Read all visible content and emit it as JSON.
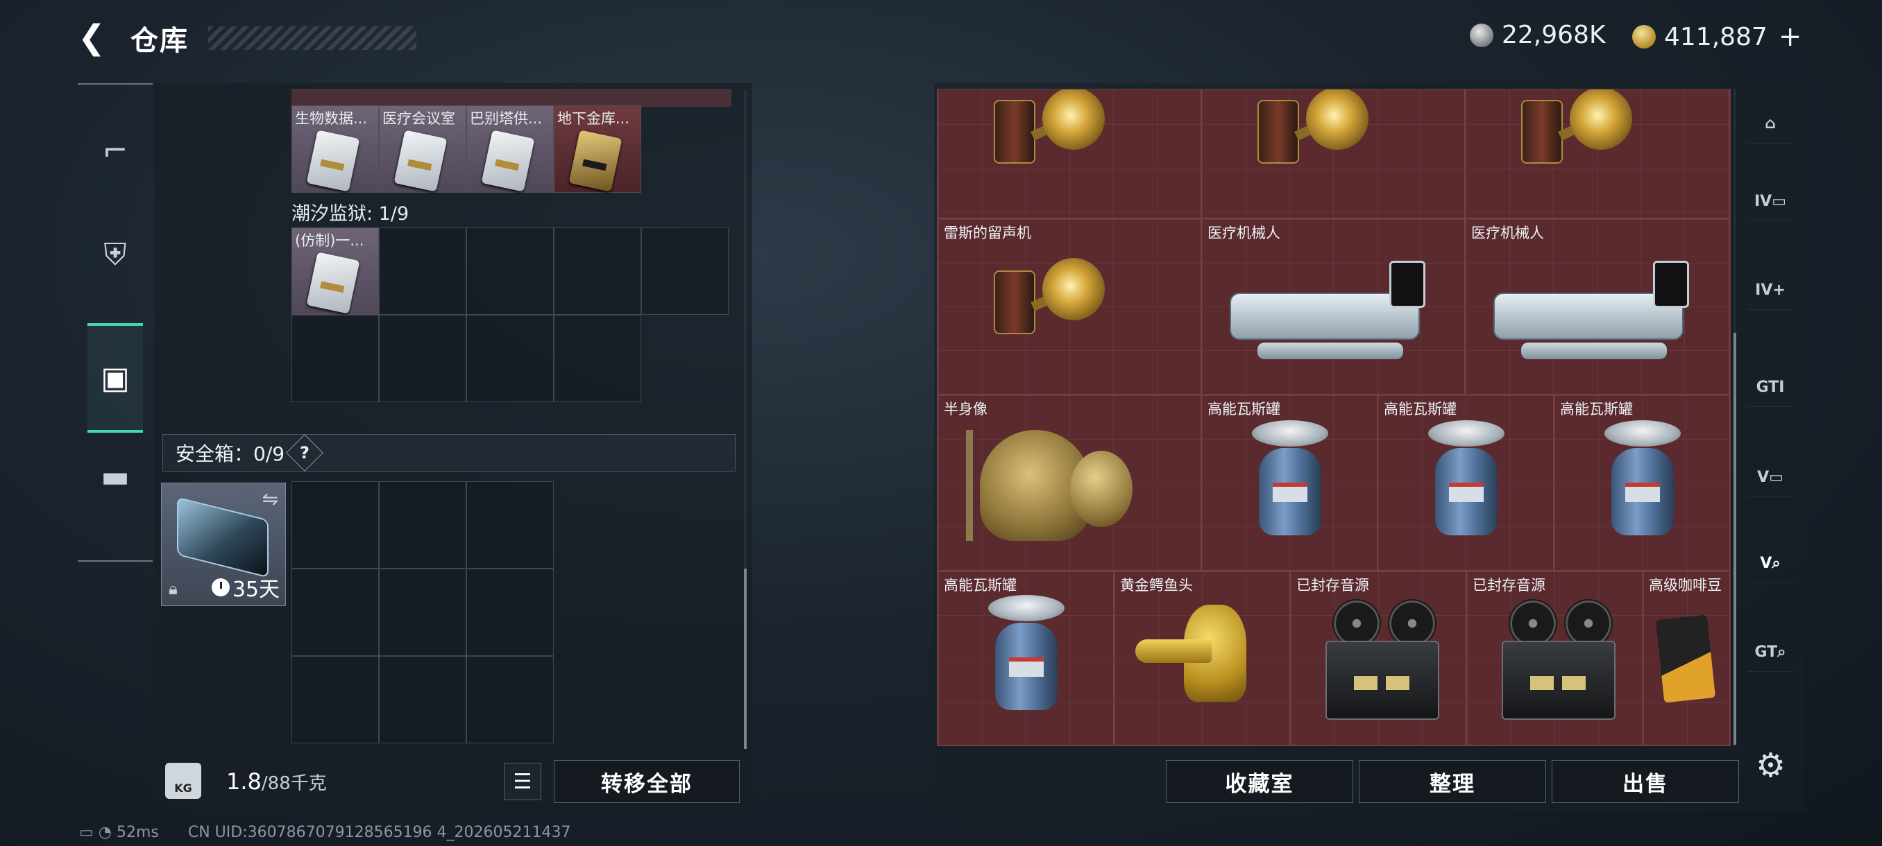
{
  "header": {
    "title": "仓库",
    "currency_silver": "22,968K",
    "currency_gold": "411,887",
    "plus": "+"
  },
  "left_nav": {
    "items": [
      {
        "icon": "gun-icon",
        "glyph": "⌐"
      },
      {
        "icon": "armor-icon",
        "glyph": "⛨"
      },
      {
        "icon": "backpack-icon",
        "glyph": "▣"
      },
      {
        "icon": "briefcase-icon",
        "glyph": "▬"
      }
    ]
  },
  "keycards": [
    {
      "label": "生物数据...",
      "style": "silver"
    },
    {
      "label": "医疗会议室",
      "style": "silver"
    },
    {
      "label": "巴别塔供...",
      "style": "silver"
    },
    {
      "label": "地下金库...",
      "style": "gold"
    }
  ],
  "prison_section": {
    "title": "潮汐监狱: 1/9",
    "items": [
      {
        "label": "(仿制)一...",
        "style": "silver"
      }
    ]
  },
  "safe_box": {
    "title": "安全箱：0/9",
    "help": "?",
    "days": "35天"
  },
  "bottom": {
    "weight_current": "1.8",
    "weight_max": "/88千克",
    "kg_label": "KG",
    "transfer_all": "转移全部"
  },
  "right_buttons": {
    "collection": "收藏室",
    "organize": "整理",
    "sell": "出售"
  },
  "right_grid": [
    {
      "label": "",
      "type": "phonograph"
    },
    {
      "label": "",
      "type": "phonograph"
    },
    {
      "label": "",
      "type": "phonograph"
    },
    {
      "label": "雷斯的留声机",
      "type": "phonograph"
    },
    {
      "label": "医疗机械人",
      "type": "robot"
    },
    {
      "label": "医疗机械人",
      "type": "robot"
    },
    {
      "label": "半身像",
      "type": "bust"
    },
    {
      "label": "高能瓦斯罐",
      "type": "tank"
    },
    {
      "label": "高能瓦斯罐",
      "type": "tank"
    },
    {
      "label": "高能瓦斯罐",
      "type": "tank"
    },
    {
      "label": "高能瓦斯罐",
      "type": "tank"
    },
    {
      "label": "黄金鳄鱼头",
      "type": "croc"
    },
    {
      "label": "已封存音源",
      "type": "reel"
    },
    {
      "label": "已封存音源",
      "type": "reel"
    },
    {
      "label": "高级咖啡豆",
      "type": "coffee"
    }
  ],
  "right_icons": [
    {
      "icon": "lobby-icon",
      "text": "⌂"
    },
    {
      "icon": "tier4-container-icon",
      "text": "IV▭"
    },
    {
      "icon": "tier4-add-icon",
      "text": "IV+"
    },
    {
      "icon": "gti-card-icon",
      "text": "GTI"
    },
    {
      "icon": "v-card-icon",
      "text": "V▭"
    },
    {
      "icon": "v-card-search-icon",
      "text": "V⌕"
    },
    {
      "icon": "gti-search-icon",
      "text": "GT⌕"
    }
  ],
  "status": {
    "ping": "52ms",
    "uid": "CN UID:3607867079128565196 4_202605211437"
  }
}
